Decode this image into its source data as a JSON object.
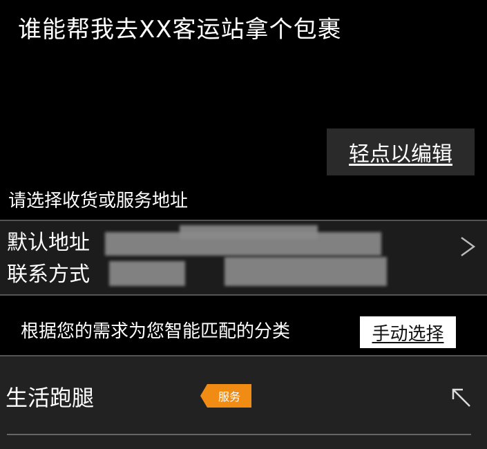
{
  "header": {
    "title": "谁能帮我去XX客运站拿个包裹"
  },
  "edit": {
    "label": "轻点以编辑"
  },
  "address": {
    "prompt": "请选择收货或服务地址",
    "default_label": "默认地址",
    "contact_label": "联系方式"
  },
  "suggest": {
    "text": "根据您的需求为您智能匹配的分类",
    "manual_label": "手动选择"
  },
  "category": {
    "name": "生活跑腿",
    "badge": "服务",
    "badge_color": "#f08c14"
  },
  "icons": {
    "address_chevron": "chevron-right-icon",
    "category_expand": "arrow-up-left-icon"
  }
}
